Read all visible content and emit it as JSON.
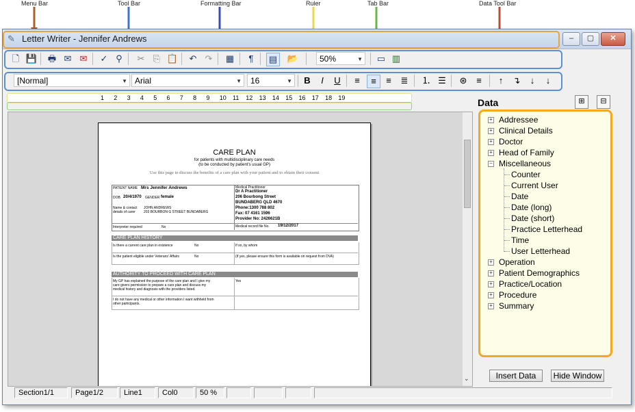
{
  "callouts": {
    "menu_bar": "Menu Bar",
    "tool_bar": "Tool Bar",
    "formatting_bar": "Formatting Bar",
    "ruler": "Ruler",
    "tab_bar": "Tab Bar",
    "data_tool_bar": "Data Tool Bar"
  },
  "window": {
    "title": "Letter Writer - Jennifer Andrews",
    "minimize": "–",
    "maximize": "▢",
    "close": "✕"
  },
  "toolbar": {
    "zoom_value": "50%"
  },
  "formatting": {
    "style_value": "[Normal]",
    "font_value": "Arial",
    "size_value": "16",
    "bold": "B",
    "italic": "I",
    "underline": "U"
  },
  "ruler": {
    "ticks": [
      "1",
      "2",
      "3",
      "4",
      "5",
      "6",
      "7",
      "8",
      "9",
      "10",
      "11",
      "12",
      "13",
      "14",
      "15",
      "16",
      "17",
      "18",
      "19"
    ]
  },
  "document": {
    "title": "CARE PLAN",
    "subtitle1": "for patients with multidisciplinary care needs",
    "subtitle2": "(to be conducted by patient's usual GP)",
    "subtitle3": "Use this page to discuss the benefits of a care plan with your patient and to obtain their consent",
    "patient_name_label": "PATIENT NAME",
    "patient_name": "Mrs Jennifer Andrews",
    "dob_label": "DOB",
    "dob": "20/4/1970",
    "gender_label": "GENDER",
    "gender": "female",
    "contact_label1": "Name & contact",
    "contact_label2": "details of carer",
    "contact_name": "JOHN ANDREWS",
    "contact_addr": "203 BOURBON G STREET BUNDABERG",
    "interpreter_label": "Interpreter required",
    "interpreter": "No",
    "mp_label": "Medical Practitioner",
    "mp_name": "Dr A Practitioner",
    "mp_street": "206 Bourbong Street",
    "mp_city": "BUNDABERG QLD 4670",
    "mp_phone": "Phone:1300 788 802",
    "mp_fax": "Fax: 07 4161 1596",
    "mp_provider": "Provider No: 2426621B",
    "mp_record_label": "Medical record file No.",
    "mp_record": "19/12/2017",
    "history_header": "CARE PLAN HISTORY",
    "hist_q1": "Is there a current care plan in existence",
    "hist_a1": "No",
    "hist_q1b": "If so, by whom",
    "hist_q2": "Is the patient eligible under Veterans' Affairs",
    "hist_a2": "No",
    "hist_q2b": "(If yes, please ensure this form is available on request from DVA)",
    "authority_header": "AUTHORITY TO PROCEED WITH CARE PLAN",
    "auth_1": "My GP has explained the purpose of the care plan and I give my",
    "auth_2": "care givers permission to prepare a care plan and discuss my",
    "auth_3": "medical history and diagnosis with the providers listed.",
    "auth_yes": "Yes",
    "auth_4": "I do not have any medical or other information I want withheld from",
    "auth_5": "other participants."
  },
  "side_panel": {
    "title": "Data",
    "tree": [
      {
        "label": "Addressee",
        "expanded": false
      },
      {
        "label": "Clinical Details",
        "expanded": false
      },
      {
        "label": "Doctor",
        "expanded": false
      },
      {
        "label": "Head of Family",
        "expanded": false
      },
      {
        "label": "Miscellaneous",
        "expanded": true
      },
      {
        "label": "Counter",
        "child": true
      },
      {
        "label": "Current User",
        "child": true
      },
      {
        "label": "Date",
        "child": true
      },
      {
        "label": "Date (long)",
        "child": true
      },
      {
        "label": "Date (short)",
        "child": true
      },
      {
        "label": "Practice Letterhead",
        "child": true
      },
      {
        "label": "Time",
        "child": true
      },
      {
        "label": "User Letterhead",
        "child": true
      },
      {
        "label": "Operation",
        "expanded": false
      },
      {
        "label": "Patient Demographics",
        "expanded": false
      },
      {
        "label": "Practice/Location",
        "expanded": false
      },
      {
        "label": "Procedure",
        "expanded": false
      },
      {
        "label": "Summary",
        "expanded": false
      }
    ],
    "insert_button": "Insert Data",
    "hide_button": "Hide Window"
  },
  "status": {
    "section": "Section1/1",
    "page": "Page1/2",
    "line": "Line1",
    "col": "Col0",
    "zoom": "50 %"
  },
  "colors": {
    "menu_highlight": "#e8a33a",
    "toolbar_highlight": "#5a8ed8",
    "tree_border": "#f3a81f",
    "tree_bg": "#fefee8"
  }
}
